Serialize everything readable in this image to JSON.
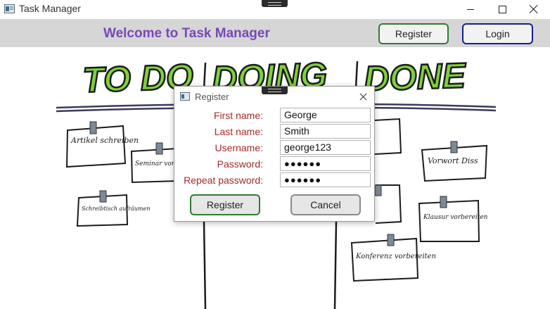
{
  "window": {
    "title": "Task Manager"
  },
  "header": {
    "welcome": "Welcome to Task Manager",
    "register_label": "Register",
    "login_label": "Login"
  },
  "board": {
    "columns": [
      "TO DO",
      "DOING",
      "DONE"
    ],
    "notes_left": [
      "Artikel schreiben",
      "Seminar vorbereiten",
      "Schreibtisch aufräumen"
    ],
    "notes_right": [
      "Vorwort Diss",
      "Klausur vorbereiten",
      "Konferenz vorbereiten"
    ],
    "colors": {
      "letters": "#7ed13a",
      "outline": "#1c1c1c",
      "pin": "#7a8a99"
    }
  },
  "dialog": {
    "title": "Register",
    "fields": [
      {
        "label": "First name:",
        "value": "George"
      },
      {
        "label": "Last name:",
        "value": "Smith"
      },
      {
        "label": "Username:",
        "value": "george123"
      },
      {
        "label": "Password:",
        "value": "●●●●●●"
      },
      {
        "label": "Repeat password:",
        "value": "●●●●●●"
      }
    ],
    "register_label": "Register",
    "cancel_label": "Cancel"
  },
  "colors": {
    "header_bg": "#d6d6d6",
    "welcome": "#7a48b8",
    "register_border": "#2f7d32",
    "login_border": "#15208f",
    "label_text": "#a52a2a"
  }
}
